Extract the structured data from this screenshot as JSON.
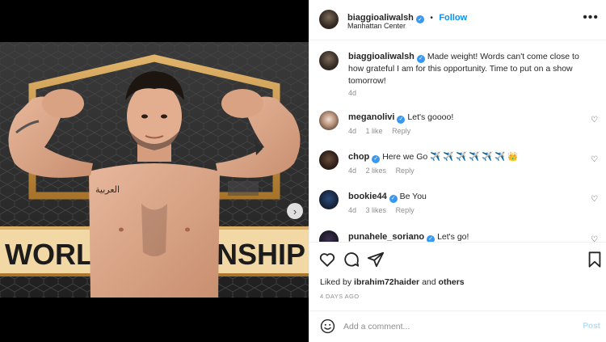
{
  "post": {
    "author": "biaggioaliwalsh",
    "follow_label": "Follow",
    "location": "Manhattan Center",
    "separator": "•"
  },
  "media": {
    "image_description": "Boxer flexing at weigh-in in front of a World Championship backdrop",
    "next_icon": "chevron-right-icon",
    "slide_index": 1,
    "slide_count": 2,
    "backdrop_text": "WORLD CHAMPIONSHIP",
    "tattoo_text": "العربية"
  },
  "caption": {
    "username": "biaggioaliwalsh",
    "text": "Made weight! Words can't come close to how grateful I am for this opportunity. Time to put on a show tomorrow!",
    "time": "4d"
  },
  "comments": [
    {
      "username": "meganolivi",
      "text": "Let's goooo!",
      "time": "4d",
      "likes": "1 like",
      "reply": "Reply"
    },
    {
      "username": "chop",
      "text": "Here we Go ✈️ ✈️ ✈️ ✈️ ✈️ ✈️ 👑",
      "time": "4d",
      "likes": "2 likes",
      "reply": "Reply"
    },
    {
      "username": "bookie44",
      "text": "Be You",
      "time": "4d",
      "likes": "3 likes",
      "reply": "Reply"
    },
    {
      "username": "punahele_soriano",
      "text": "Let's go!",
      "time": "",
      "likes": "",
      "reply": ""
    }
  ],
  "actions": {
    "liked_prefix": "Liked by",
    "liked_user": "ibrahim72haider",
    "liked_and": "and",
    "liked_others": "others",
    "timestamp": "4 DAYS AGO"
  },
  "add_comment": {
    "placeholder": "Add a comment...",
    "post_label": "Post"
  },
  "colors": {
    "link_blue": "#0095f6",
    "verified_blue": "#3897f0",
    "muted_gray": "#8e8e8e",
    "post_disabled": "#b2dffc",
    "border": "#efefef"
  }
}
